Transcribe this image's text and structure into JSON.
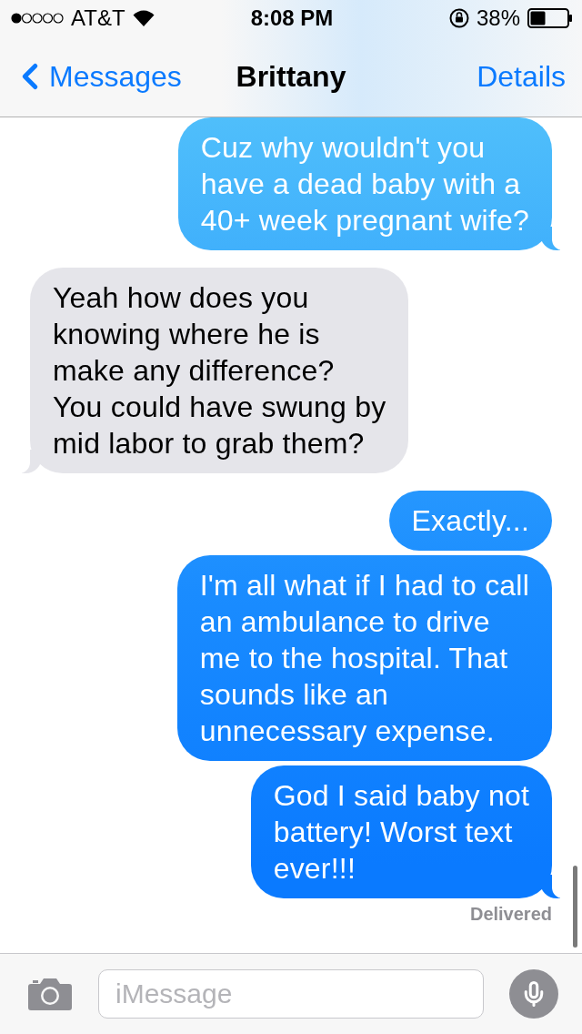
{
  "status_bar": {
    "carrier": "AT&T",
    "time": "8:08 PM",
    "battery": "38%"
  },
  "nav": {
    "back": "Messages",
    "title": "Brittany",
    "action": "Details"
  },
  "messages": [
    {
      "kind": "sent",
      "tail": true,
      "text": "Cuz why wouldn't you\nhave a dead baby with a\n40+ week pregnant wife?"
    },
    {
      "kind": "received",
      "tail": true,
      "text": "Yeah how does you\nknowing where he is\nmake any difference?\nYou could have swung by\nmid labor to grab them?"
    },
    {
      "kind": "sent",
      "tail": false,
      "text": "Exactly..."
    },
    {
      "kind": "sent",
      "tail": false,
      "text": "I'm all what if I had to call\nan ambulance to drive\nme to the hospital. That\nsounds like an\nunnecessary expense."
    },
    {
      "kind": "sent",
      "tail": true,
      "text": "God I said baby not\nbattery! Worst text\never!!!"
    }
  ],
  "receipt": "Delivered",
  "composer": {
    "placeholder": "iMessage"
  }
}
